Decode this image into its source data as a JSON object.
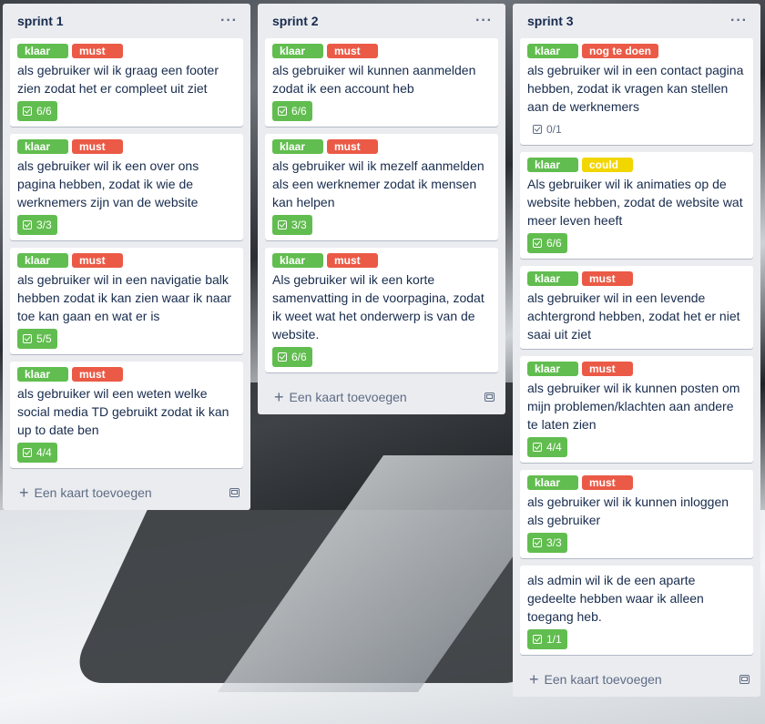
{
  "colors": {
    "green": "#61bd4f",
    "red": "#eb5a46",
    "yellow": "#f2d600",
    "list_bg": "#ebecf0"
  },
  "add_card_label": "Een kaart toevoegen",
  "lists": [
    {
      "title": "sprint 1",
      "cards": [
        {
          "labels": [
            {
              "text": "klaar",
              "color": "#61bd4f"
            },
            {
              "text": "must",
              "color": "#eb5a46"
            }
          ],
          "title": "als gebruiker wil ik graag een footer zien zodat het er compleet uit ziet",
          "checklist": "6/6",
          "complete": true
        },
        {
          "labels": [
            {
              "text": "klaar",
              "color": "#61bd4f"
            },
            {
              "text": "must",
              "color": "#eb5a46"
            }
          ],
          "title": "als gebruiker wil ik een over ons pagina hebben, zodat ik wie de werknemers zijn van de website",
          "checklist": "3/3",
          "complete": true
        },
        {
          "labels": [
            {
              "text": "klaar",
              "color": "#61bd4f"
            },
            {
              "text": "must",
              "color": "#eb5a46"
            }
          ],
          "title": "als gebruiker wil in een navigatie balk hebben zodat ik kan zien waar ik naar toe kan gaan en wat er is",
          "checklist": "5/5",
          "complete": true
        },
        {
          "labels": [
            {
              "text": "klaar",
              "color": "#61bd4f"
            },
            {
              "text": "must",
              "color": "#eb5a46"
            }
          ],
          "title": "als gebruiker wil een weten welke social media TD gebruikt zodat ik kan up to date ben",
          "checklist": "4/4",
          "complete": true
        }
      ]
    },
    {
      "title": "sprint 2",
      "cards": [
        {
          "labels": [
            {
              "text": "klaar",
              "color": "#61bd4f"
            },
            {
              "text": "must",
              "color": "#eb5a46"
            }
          ],
          "title": "als gebruiker wil kunnen aanmelden zodat ik een account heb",
          "checklist": "6/6",
          "complete": true
        },
        {
          "labels": [
            {
              "text": "klaar",
              "color": "#61bd4f"
            },
            {
              "text": "must",
              "color": "#eb5a46"
            }
          ],
          "title": "als gebruiker wil ik mezelf aanmelden als een werknemer zodat ik mensen kan helpen",
          "checklist": "3/3",
          "complete": true
        },
        {
          "labels": [
            {
              "text": "klaar",
              "color": "#61bd4f"
            },
            {
              "text": "must",
              "color": "#eb5a46"
            }
          ],
          "title": "Als gebruiker wil ik een korte samenvatting in de voorpagina, zodat ik weet wat het onderwerp is van de website.",
          "checklist": "6/6",
          "complete": true
        }
      ]
    },
    {
      "title": "sprint 3",
      "cards": [
        {
          "labels": [
            {
              "text": "klaar",
              "color": "#61bd4f"
            },
            {
              "text": "nog te doen",
              "color": "#eb5a46"
            }
          ],
          "title": "als gebruiker wil in een contact pagina hebben, zodat ik vragen kan stellen aan de werknemers",
          "checklist": "0/1",
          "complete": false
        },
        {
          "labels": [
            {
              "text": "klaar",
              "color": "#61bd4f"
            },
            {
              "text": "could",
              "color": "#f2d600"
            }
          ],
          "title": "Als gebruiker wil ik animaties op de website hebben, zodat de website wat meer leven heeft",
          "checklist": "6/6",
          "complete": true
        },
        {
          "labels": [
            {
              "text": "klaar",
              "color": "#61bd4f"
            },
            {
              "text": "must",
              "color": "#eb5a46"
            }
          ],
          "title": "als gebruiker wil in een levende achtergrond hebben, zodat het er niet saai uit ziet",
          "checklist": null,
          "complete": true
        },
        {
          "labels": [
            {
              "text": "klaar",
              "color": "#61bd4f"
            },
            {
              "text": "must",
              "color": "#eb5a46"
            }
          ],
          "title": "als gebruiker wil ik kunnen posten om mijn problemen/klachten aan andere te laten zien",
          "checklist": "4/4",
          "complete": true
        },
        {
          "labels": [
            {
              "text": "klaar",
              "color": "#61bd4f"
            },
            {
              "text": "must",
              "color": "#eb5a46"
            }
          ],
          "title": "als gebruiker wil ik kunnen inloggen als gebruiker",
          "checklist": "3/3",
          "complete": true
        },
        {
          "labels": [],
          "title": "als admin wil ik de een aparte gedeelte hebben waar ik alleen toegang heb.",
          "checklist": "1/1",
          "complete": true
        }
      ]
    }
  ]
}
